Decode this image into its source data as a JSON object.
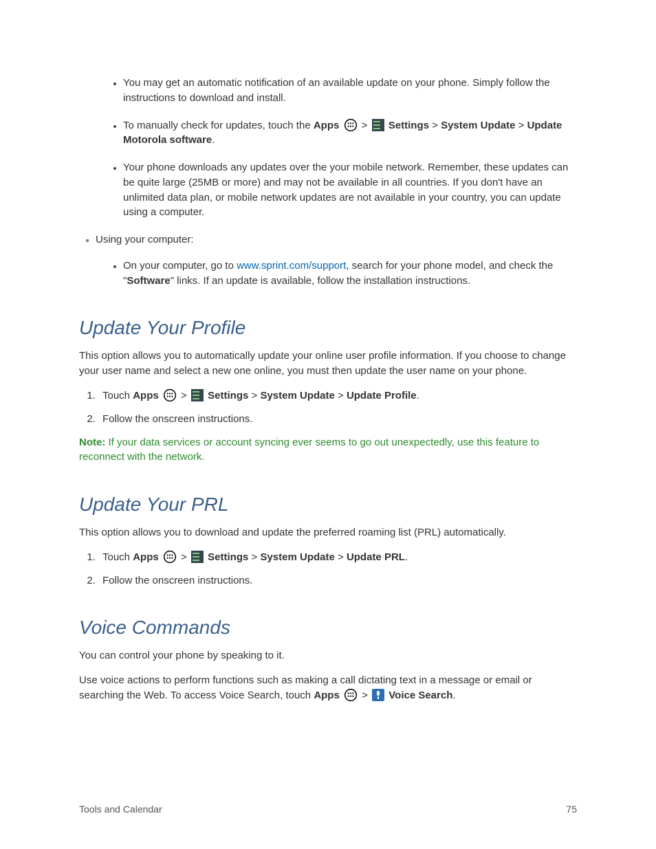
{
  "bullets": {
    "b1": "You may get an automatic notification of an available update on your phone. Simply follow the instructions to download and install.",
    "b2_pre": "To manually check for updates, touch the ",
    "b2_apps": "Apps",
    "b2_gt1": " > ",
    "b2_settings": "Settings",
    "b2_gt2": " > ",
    "b2_sysupd": "System Update",
    "b2_gt3": " > ",
    "b2_motorola": "Update Motorola software",
    "b2_period": ".",
    "b3": "Your phone downloads any updates over the your mobile network. Remember, these updates can be quite large (25MB or more) and may not be available in all countries. If you don't have an unlimited data plan, or mobile network updates are not available in your country, you can update using a computer.",
    "sq": "Using your computer:",
    "comp_pre": "On your computer, go to ",
    "comp_link": "www.sprint.com/support",
    "comp_mid": ", search for your phone model, and check the \"",
    "comp_software": "Software",
    "comp_post": "\" links. If an update is available, follow the installation instructions."
  },
  "profile": {
    "h": "Update Your Profile",
    "p": "This option allows you to automatically update your online user profile information. If you choose to change your user name and select a new one online, you must then update the user name on your phone.",
    "s1_pre": "Touch ",
    "s1_apps": "Apps",
    "s1_gt1": " > ",
    "s1_settings": "Settings",
    "s1_gt2": " > ",
    "s1_sysupd": "System Update",
    "s1_gt3": " > ",
    "s1_updprof": "Update Profile",
    "s1_period": ".",
    "s2": "Follow the onscreen instructions.",
    "note_label": "Note:",
    "note_body": " If your data services or account syncing ever seems to go out unexpectedly, use this feature to reconnect with the network."
  },
  "prl": {
    "h": "Update Your PRL",
    "p": "This option allows you to download and update the preferred roaming list (PRL) automatically.",
    "s1_pre": "Touch  ",
    "s1_apps": "Apps",
    "s1_gt1": " > ",
    "s1_settings": "Settings",
    "s1_gt2": " > ",
    "s1_sysupd": "System Update",
    "s1_gt3": " > ",
    "s1_updprl": "Update PRL",
    "s1_period": ".",
    "s2": "Follow the onscreen instructions."
  },
  "voice": {
    "h": "Voice Commands",
    "p1": "You can control your phone by speaking to it.",
    "p2_pre": "Use voice actions to perform functions such as making a call dictating text in a message or email or searching the Web. To access Voice Search, touch ",
    "p2_apps": "Apps",
    "p2_gt1": " > ",
    "p2_vs": "Voice Search",
    "p2_period": "."
  },
  "footer": {
    "section": "Tools and Calendar",
    "page": "75"
  }
}
